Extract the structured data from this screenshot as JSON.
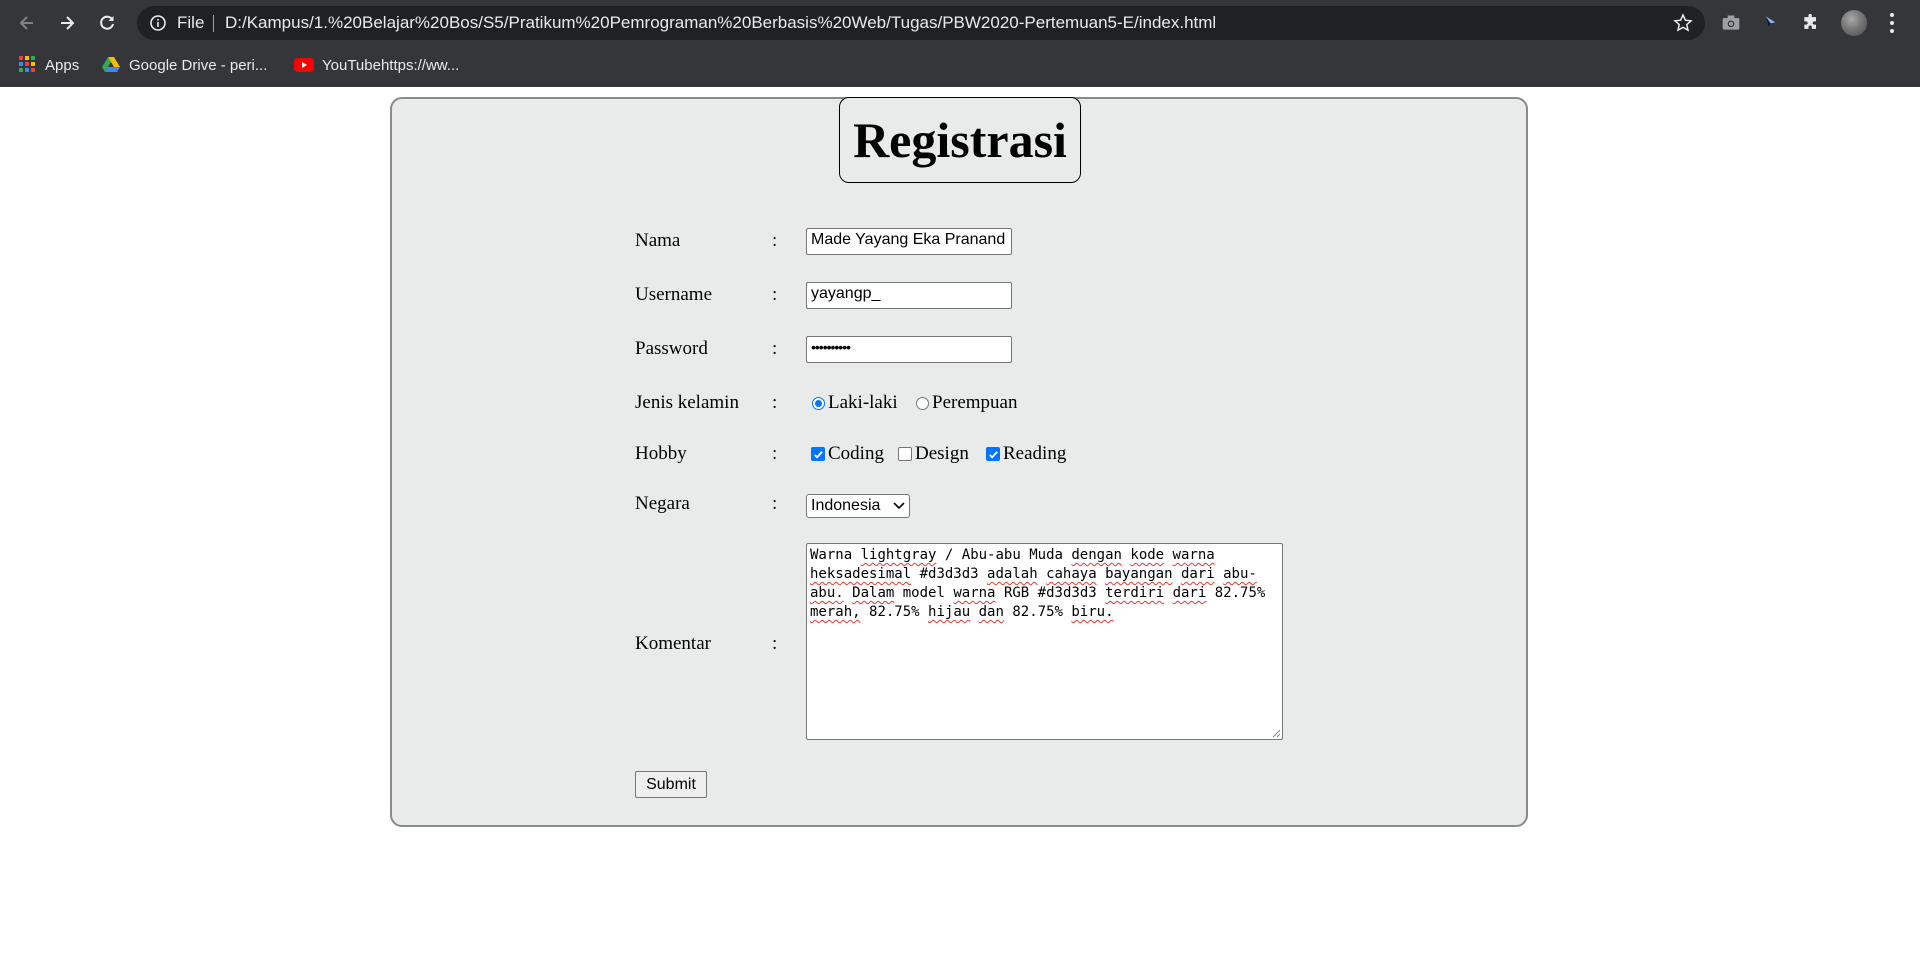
{
  "browser": {
    "file_label": "File",
    "url": "D:/Kampus/1.%20Belajar%20Bos/S5/Pratikum%20Pemrograman%20Berbasis%20Web/Tugas/PBW2020-Pertemuan5-E/index.html",
    "bookmarks": [
      {
        "label": "Apps",
        "icon": "apps-grid-icon"
      },
      {
        "label": "Google Drive - peri...",
        "icon": "google-drive-icon"
      },
      {
        "label": "YouTubehttps://ww...",
        "icon": "youtube-icon"
      }
    ],
    "extensions": [
      "camera-icon",
      "cursor-icon",
      "puzzle-icon"
    ]
  },
  "form": {
    "title": "Registrasi",
    "colon": ":",
    "fields": {
      "nama": {
        "label": "Nama",
        "value": "Made Yayang Eka Pranand"
      },
      "username": {
        "label": "Username",
        "value": "yayangp_"
      },
      "password": {
        "label": "Password",
        "value": "••••••••••"
      },
      "gender": {
        "label": "Jenis kelamin",
        "options": [
          {
            "label": "Laki-laki",
            "checked": true
          },
          {
            "label": "Perempuan",
            "checked": false
          }
        ]
      },
      "hobby": {
        "label": "Hobby",
        "options": [
          {
            "label": "Coding",
            "checked": true
          },
          {
            "label": "Design",
            "checked": false
          },
          {
            "label": "Reading",
            "checked": true
          }
        ]
      },
      "negara": {
        "label": "Negara",
        "selected": "Indonesia"
      },
      "komentar": {
        "label": "Komentar",
        "value": "Warna lightgray / Abu-abu Muda dengan kode warna heksadesimal #d3d3d3 adalah cahaya bayangan dari abu-abu. Dalam model warna RGB #d3d3d3 terdiri dari 82.75% merah, 82.75% hijau dan 82.75% biru."
      }
    },
    "submit_label": "Submit"
  },
  "colors": {
    "chrome_bg": "#35363a",
    "omnibox_bg": "#202124",
    "fieldset_bg": "#e9eaea",
    "accent": "#0075ff"
  }
}
